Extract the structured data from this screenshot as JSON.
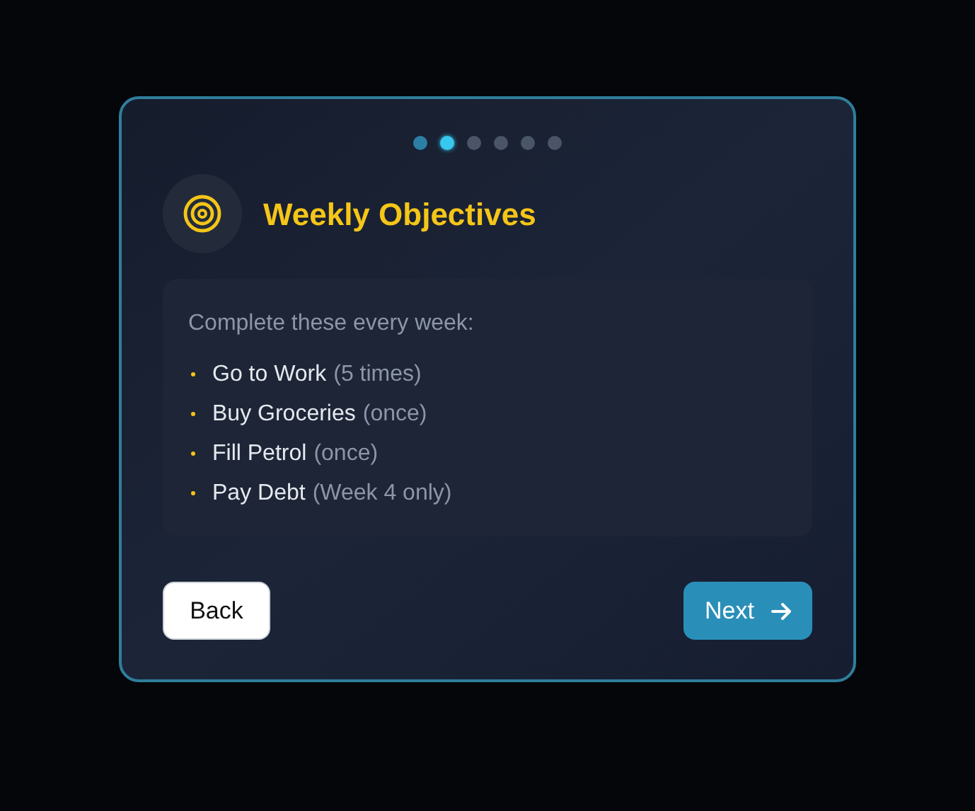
{
  "steps": [
    {
      "selected": false,
      "done": true
    },
    {
      "selected": true,
      "done": false
    },
    {
      "selected": false,
      "done": false
    },
    {
      "selected": false,
      "done": false
    },
    {
      "selected": false,
      "done": false
    },
    {
      "selected": false,
      "done": false
    }
  ],
  "title": "Weekly Objectives",
  "intro": "Complete these every week:",
  "objectives": [
    {
      "label": "Go to Work",
      "note": "(5 times)"
    },
    {
      "label": "Buy Groceries",
      "note": "(once)"
    },
    {
      "label": "Fill Petrol",
      "note": "(once)"
    },
    {
      "label": "Pay Debt",
      "note": "(Week 4 only)"
    }
  ],
  "buttons": {
    "back": "Back",
    "next": "Next"
  }
}
